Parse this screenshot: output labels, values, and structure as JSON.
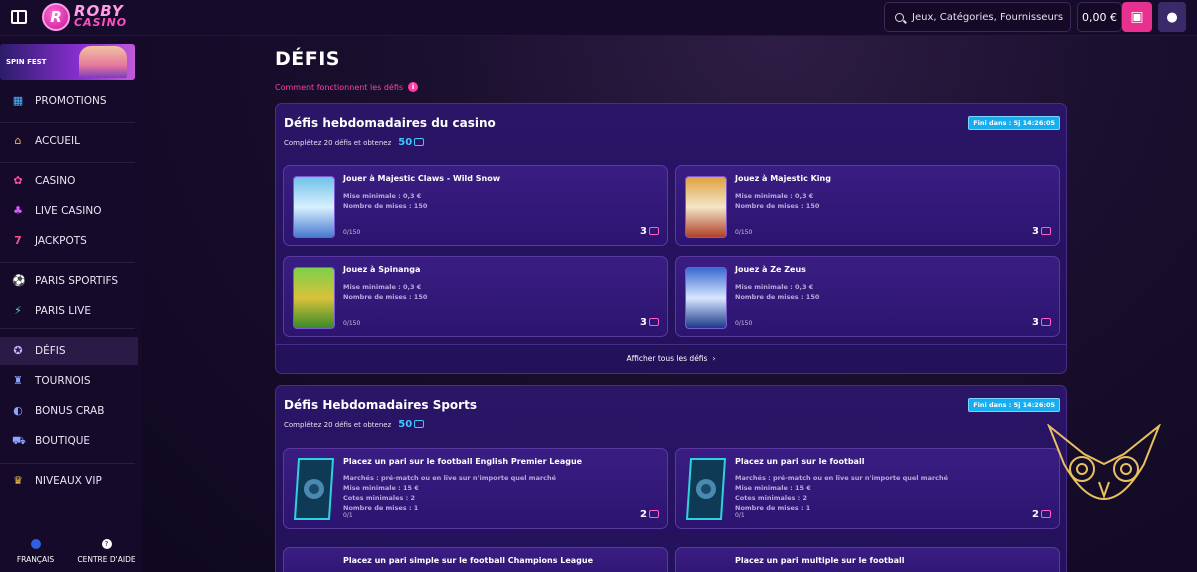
{
  "header": {
    "logo_line1": "ROBY",
    "logo_line2": "CASINO",
    "logo_letter": "R",
    "search_placeholder": "Jeux, Catégories, Fournisseurs",
    "balance": "0,00 €"
  },
  "sidebar": {
    "banner_label": "SPIN FEST",
    "items": [
      {
        "label": "PROMOTIONS",
        "icon": "gift-icon"
      },
      {
        "label": "ACCUEIL",
        "icon": "home-icon"
      },
      {
        "label": "CASINO",
        "icon": "casino-chip-icon"
      },
      {
        "label": "LIVE CASINO",
        "icon": "microphone-icon"
      },
      {
        "label": "JACKPOTS",
        "icon": "seven-icon"
      },
      {
        "label": "PARIS SPORTIFS",
        "icon": "soccer-ball-icon"
      },
      {
        "label": "PARIS LIVE",
        "icon": "lightning-icon"
      },
      {
        "label": "DÉFIS",
        "icon": "medal-icon"
      },
      {
        "label": "TOURNOIS",
        "icon": "trophy-icon"
      },
      {
        "label": "BONUS CRAB",
        "icon": "claw-icon"
      },
      {
        "label": "BOUTIQUE",
        "icon": "cart-icon"
      },
      {
        "label": "NIVEAUX VIP",
        "icon": "crown-icon"
      }
    ],
    "footer_language": "FRANÇAIS",
    "footer_help": "CENTRE D'AIDE"
  },
  "page": {
    "title": "DÉFIS",
    "help_link": "Comment fonctionnent les défis"
  },
  "casino_section": {
    "title": "Défis hebdomadaires du casino",
    "subtitle": "Complétez 20 défis et obtenez",
    "points": "50",
    "timer": "Fini dans : 5j 14:26:05",
    "see_all": "Afficher tous les défis",
    "cards": [
      {
        "title": "Jouer à Majestic Claws - Wild Snow",
        "line1": "Mise minimale : 0,3 €",
        "line2": "Nombre de mises : 150",
        "progress": "0/150",
        "reward": "3"
      },
      {
        "title": "Jouez à Majestic King",
        "line1": "Mise minimale : 0,3 €",
        "line2": "Nombre de mises : 150",
        "progress": "0/150",
        "reward": "3"
      },
      {
        "title": "Jouez à Spinanga",
        "line1": "Mise minimale : 0,3 €",
        "line2": "Nombre de mises : 150",
        "progress": "0/150",
        "reward": "3"
      },
      {
        "title": "Jouez à Ze Zeus",
        "line1": "Mise minimale : 0,3 €",
        "line2": "Nombre de mises : 150",
        "progress": "0/150",
        "reward": "3"
      }
    ]
  },
  "sports_section": {
    "title": "Défis Hebdomadaires Sports",
    "subtitle": "Complétez 20 défis et obtenez",
    "points": "50",
    "timer": "Fini dans : 5j 14:26:05",
    "cards": [
      {
        "title": "Placez un pari sur le football English Premier League",
        "line1": "Marchés : pré-match ou en live sur n'importe quel marché",
        "line2": "Mise minimale : 15 €",
        "line3": "Cotes minimales : 2",
        "line4": "Nombre de mises : 1",
        "progress": "0/1",
        "reward": "2"
      },
      {
        "title": "Placez un pari sur le football",
        "line1": "Marchés : pré-match ou en live sur n'importe quel marché",
        "line2": "Mise minimale : 15 €",
        "line3": "Cotes minimales : 2",
        "line4": "Nombre de mises : 1",
        "progress": "0/1",
        "reward": "2"
      },
      {
        "title": "Placez un pari simple sur le football Champions League"
      },
      {
        "title": "Placez un pari multiple sur le football"
      }
    ]
  },
  "colors": {
    "accent_pink": "#ff3fa7",
    "points_blue": "#3fc8ff",
    "timer_blue": "#16aef0",
    "card_bg": "#2c1470"
  }
}
